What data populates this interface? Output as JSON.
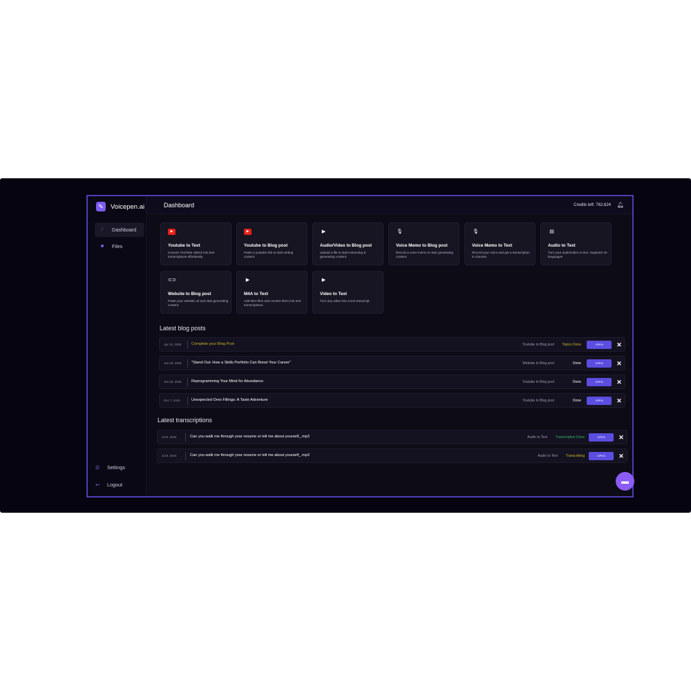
{
  "brand": {
    "name": "Voicepen.ai"
  },
  "sidebar": {
    "items": [
      {
        "label": "Dashboard",
        "icon": "wand-icon"
      },
      {
        "label": "Files",
        "icon": "folder-icon"
      }
    ],
    "bottom": [
      {
        "label": "Settings",
        "icon": "settings-icon"
      },
      {
        "label": "Logout",
        "icon": "logout-icon"
      }
    ]
  },
  "header": {
    "title": "Dashboard",
    "credits": "Credits left: 762,624",
    "bell_icon": "bell-icon"
  },
  "cards": [
    {
      "title": "Youtube to Text",
      "desc": "Convert YouTube videos into text transcriptions effortlessly.",
      "icon": "youtube-icon"
    },
    {
      "title": "Youtube to Blog post",
      "desc": "Paste a youtube link to start writing content.",
      "icon": "youtube-icon"
    },
    {
      "title": "Audio/Video to Blog post",
      "desc": "Upload a file to start extracting & generating content.",
      "icon": "play-icon"
    },
    {
      "title": "Voice Memo to Blog post",
      "desc": "Record a voice memo to start generating content.",
      "icon": "microphone-icon"
    },
    {
      "title": "Voice Memo to Text",
      "desc": "Record your voice and get a transcription in minutes.",
      "icon": "microphone-icon"
    },
    {
      "title": "Audio to Text",
      "desc": "Turn your audio/video to text. Supports 19 languages",
      "icon": "document-icon"
    },
    {
      "title": "Website to Blog post",
      "desc": "Paste your website url and start generating content.",
      "icon": "link-icon"
    },
    {
      "title": "M4A to Text",
      "desc": "Add M4A files and convert them into text transcriptions.",
      "icon": "play-icon"
    },
    {
      "title": "Video to Text",
      "desc": "Turn any video into a text transcript.",
      "icon": "play-icon"
    }
  ],
  "blog": {
    "heading": "Latest blog posts",
    "rows": [
      {
        "date": "Apr 23, 2025",
        "title": "Complete your Blog Post",
        "type": "Youtube to Blog post",
        "status": "Topics Done",
        "open": "OPEN"
      },
      {
        "date": "Jan 29, 2025",
        "title": "\"Stand Out: How a Skills Portfolio Can Boost Your Career\"",
        "type": "Website to Blog post",
        "status": "Done",
        "open": "OPEN"
      },
      {
        "date": "Jan 28, 2025",
        "title": "Reprogramming Your Mind for Abundance",
        "type": "Youtube to Blog post",
        "status": "Done",
        "open": "OPEN"
      },
      {
        "date": "Dec 7, 2024",
        "title": "Unexpected Oreo Fillings: A Taste Adventure",
        "type": "Youtube to Blog post",
        "status": "Done",
        "open": "OPEN"
      }
    ]
  },
  "transcriptions": {
    "heading": "Latest transcriptions",
    "rows": [
      {
        "date": "Jul 5, 2024",
        "title": "Can you walk me through your resume or tell me about yourself_.mp3",
        "type": "Audio to Text",
        "status": "Transcription Done",
        "open": "OPEN"
      },
      {
        "date": "Jul 5, 2024",
        "title": "Can you walk me through your resume or tell me about yourself_.mp3",
        "type": "Audio to Text",
        "status": "Transcribing",
        "open": "OPEN"
      }
    ]
  },
  "colors": {
    "accent": "#5b4de0",
    "frame": "#4a3fb8",
    "status_yellow": "#c8b22a",
    "status_green": "#36b36a",
    "youtube_red": "#e62117"
  }
}
